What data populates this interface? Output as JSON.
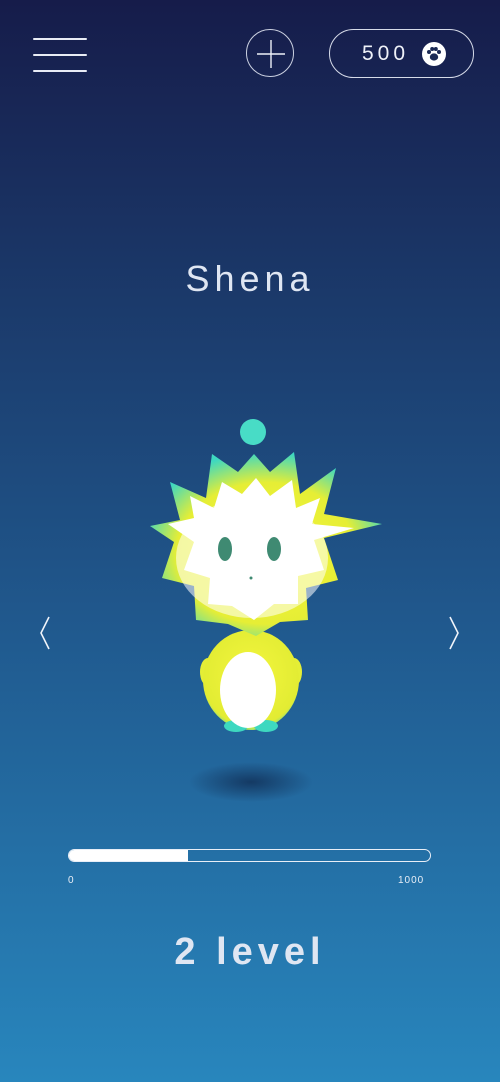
{
  "header": {
    "menu_icon": "hamburger-menu-icon",
    "add_icon": "plus-icon",
    "balance": "500",
    "balance_icon": "paw-icon"
  },
  "pet": {
    "name": "Shena",
    "colors": {
      "body": "#f0f23c",
      "accent": "#3ed8c0",
      "face": "#ffffff",
      "eyes": "#3f8a72"
    }
  },
  "navigation": {
    "previous_icon": "chevron-left-icon",
    "next_icon": "chevron-right-icon"
  },
  "progress": {
    "min_label": "0",
    "max_label": "1000",
    "fraction": 0.33
  },
  "level": {
    "label": "2 level"
  },
  "colors": {
    "background_top": "#161c4a",
    "background_bottom": "#2886bd",
    "text": "#dfe6f2"
  }
}
